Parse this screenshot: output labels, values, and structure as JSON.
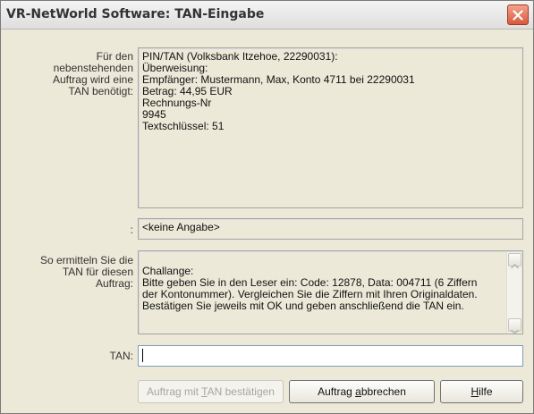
{
  "window": {
    "title": "VR-NetWorld Software: TAN-Eingabe"
  },
  "labels": {
    "order": "Für den\nnebenstehenden\nAuftrag wird eine\nTAN benötigt:",
    "colon": ":",
    "method": "So ermitteln Sie die\nTAN für diesen\nAuftrag:",
    "tan": "TAN:"
  },
  "order_details": "PIN/TAN (Volksbank Itzehoe, 22290031):\nÜberweisung:\nEmpfänger: Mustermann, Max, Konto 4711 bei 22290031\nBetrag: 44,95 EUR\nRechnungs-Nr\n9945\nTextschlüssel: 51",
  "extra_info": "<keine Angabe>",
  "challenge_text": "Challange:\nBitte geben Sie in den Leser ein: Code: 12878, Data: 004711 (6 Ziffern\nder Kontonummer). Vergleichen Sie die Ziffern mit Ihren Originaldaten.\nBestätigen Sie jeweils mit OK und geben anschließend die TAN ein.",
  "tan_input": {
    "value": "",
    "placeholder": ""
  },
  "buttons": {
    "confirm": {
      "pre": "Auftrag mit ",
      "key": "T",
      "post": "AN bestätigen",
      "enabled": false
    },
    "cancel": {
      "pre": "Auftrag ",
      "key": "a",
      "post": "bbrechen"
    },
    "help": {
      "pre": "",
      "key": "H",
      "post": "ilfe"
    }
  },
  "icons": {
    "close": "close-icon",
    "scroll_up": "scroll-up-arrow-icon",
    "scroll_down": "scroll-down-arrow-icon"
  },
  "colors": {
    "close_button": "#d9593c",
    "window_bg": "#ece9d8"
  }
}
